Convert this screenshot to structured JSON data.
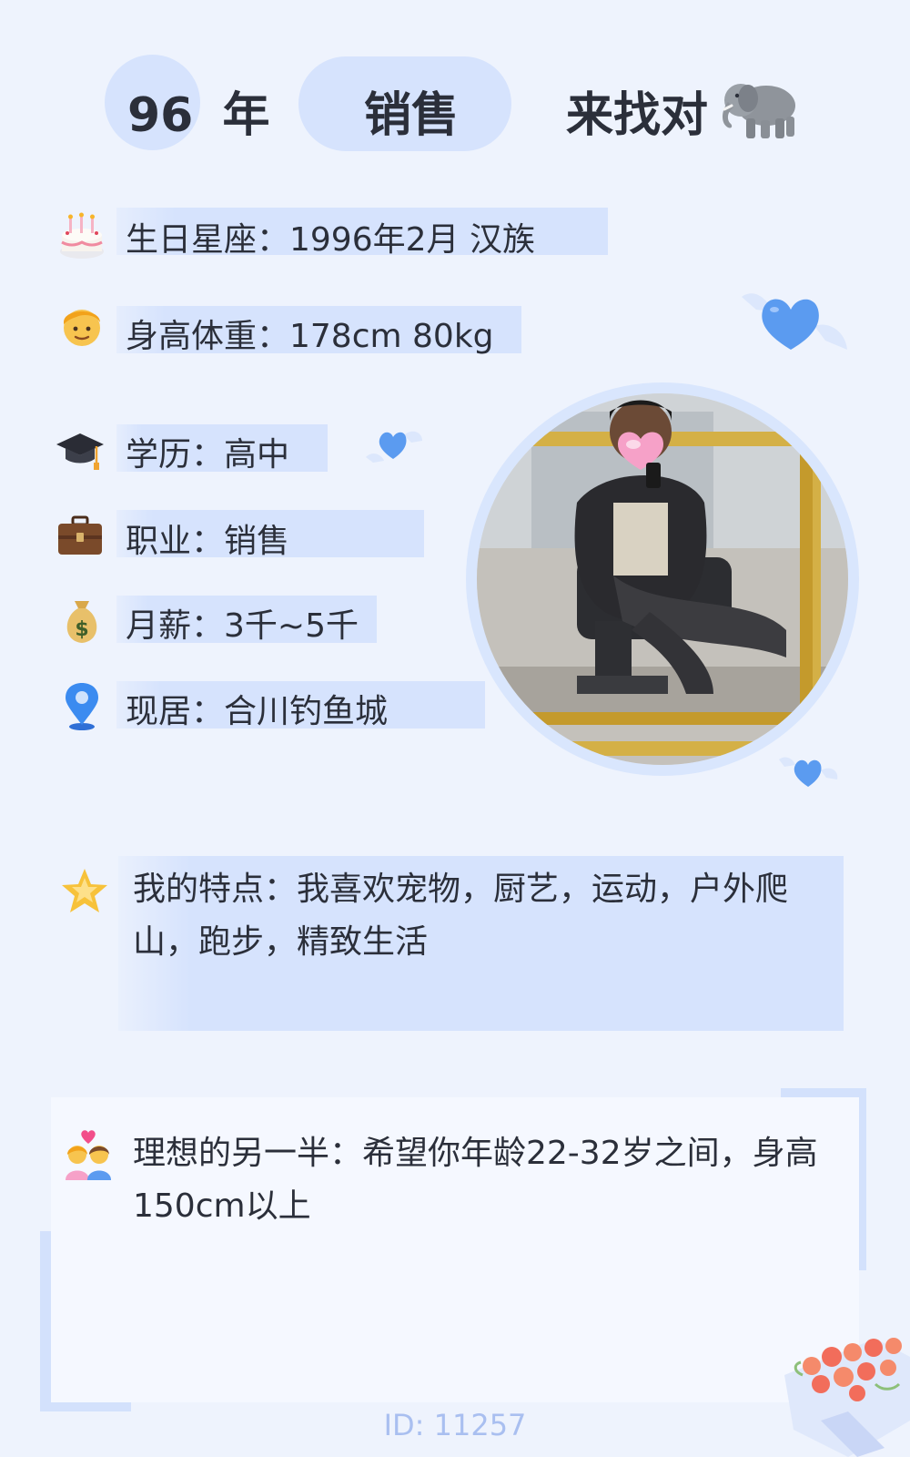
{
  "header": {
    "year_num": "96",
    "year_unit": "年",
    "occupation": "销售",
    "seeking": "来找对"
  },
  "info": {
    "birthday": "生日星座：1996年2月 汉族",
    "height_weight": "身高体重：178cm 80kg",
    "education": "学历：高中",
    "job": "职业：销售",
    "salary": "月薪：3千~5千",
    "residence": "现居：合川钓鱼城"
  },
  "features": {
    "line1": "我的特点：我喜欢宠物，厨艺，运动，户外爬",
    "line2": "山，跑步，精致生活"
  },
  "ideal": {
    "line1": "理想的另一半：希望你年龄22-32岁之间，身高",
    "line2": "150cm以上"
  },
  "footer": {
    "id_text": "ID: 11257"
  },
  "icons": {
    "birthday": "cake-icon",
    "height": "person-icon",
    "education": "graduation-cap-icon",
    "job": "briefcase-icon",
    "salary": "money-bag-icon",
    "residence": "location-pin-icon",
    "features": "star-icon",
    "ideal": "couple-icon",
    "header": "elephant-icon"
  },
  "colors": {
    "background": "#eef3fd",
    "highlight": "#d6e3fd",
    "heart": "#5b9bf0",
    "id_text": "#a9bff0"
  }
}
